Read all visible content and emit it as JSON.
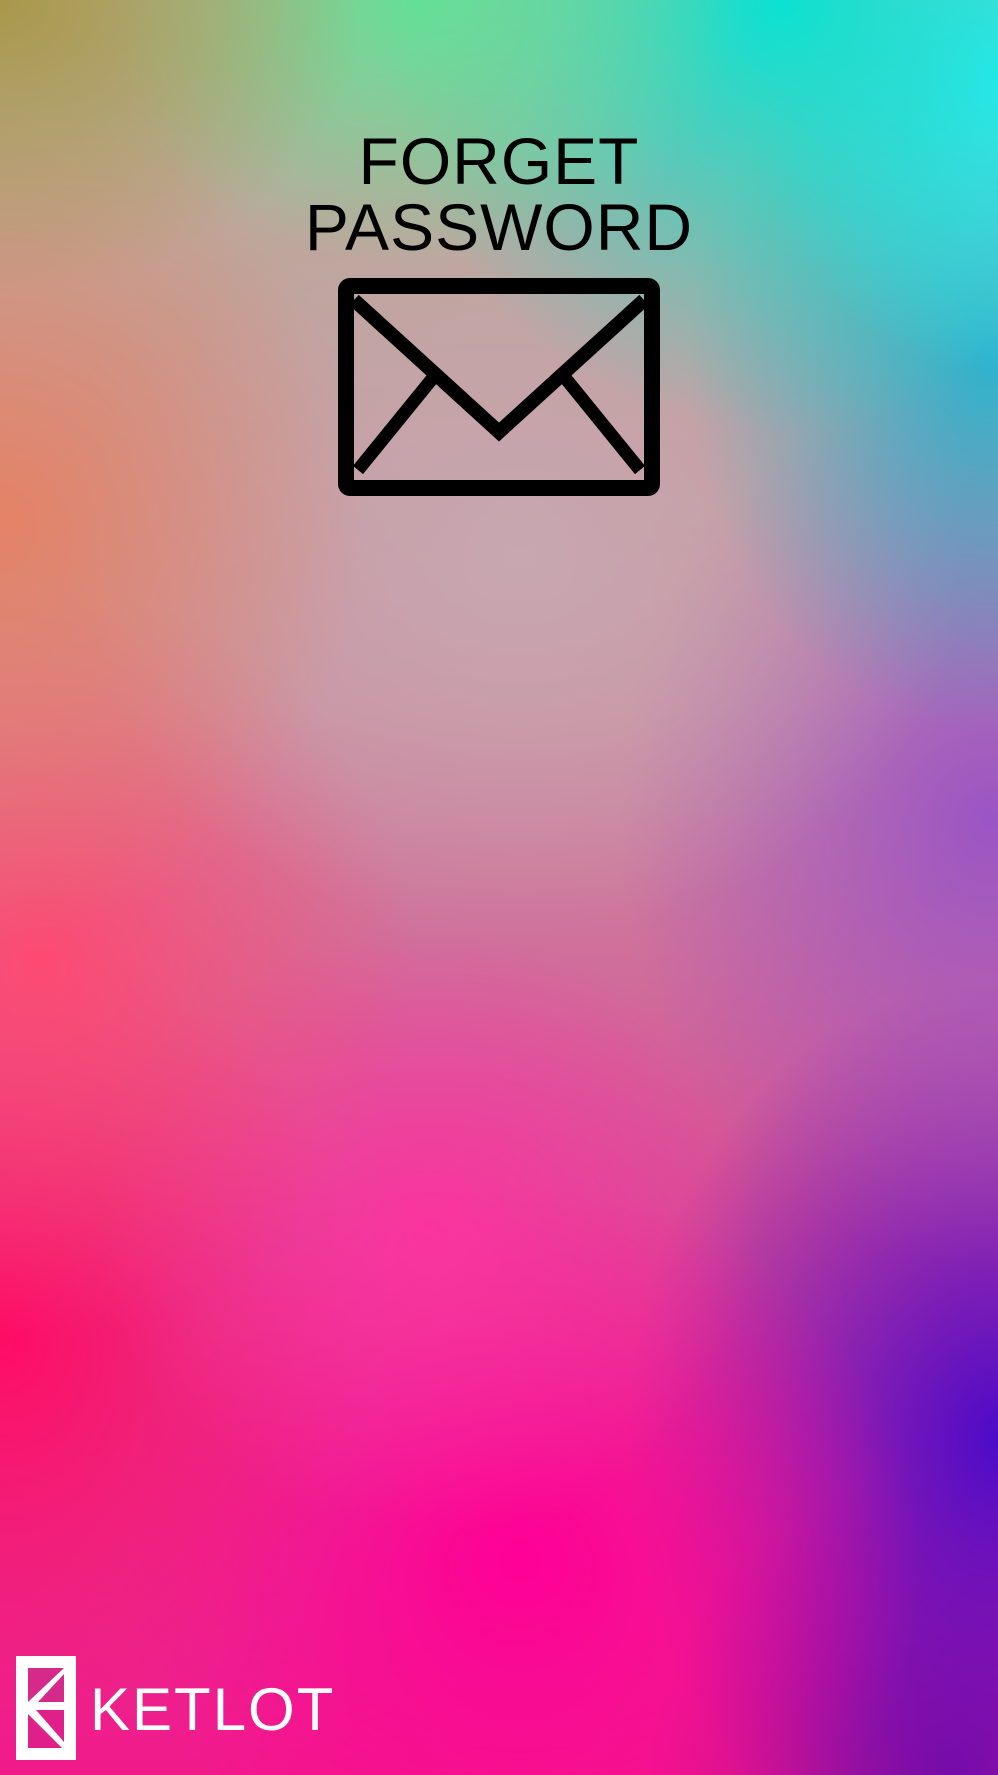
{
  "page": {
    "title_line1": "FORGET",
    "title_line2": "PASSWORD"
  },
  "icons": {
    "mail": "envelope-icon",
    "brand_logo": "ketlot-logo-icon"
  },
  "brand": {
    "name": "KETLOT"
  },
  "colors": {
    "title_text": "#000000",
    "brand_text": "#ffffff",
    "gradient_top_left": "#a8964a",
    "gradient_top_right": "#38ecf6",
    "gradient_bottom_left": "#ff0c64",
    "gradient_bottom_right": "#4c0ac8"
  }
}
